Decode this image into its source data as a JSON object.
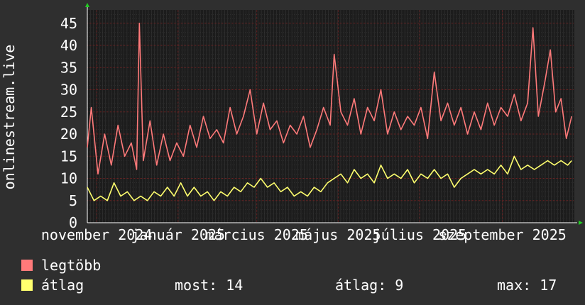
{
  "chart_data": {
    "type": "line",
    "ylabel": "onlinestream.live",
    "ylim": [
      0,
      48
    ],
    "yticks": [
      0,
      5,
      10,
      15,
      20,
      25,
      30,
      35,
      40,
      45
    ],
    "x_range": [
      "2024-10-25",
      "2025-10-25"
    ],
    "xtick_labels": [
      {
        "label": "november 2024",
        "date": "2024-11-01"
      },
      {
        "label": "január 2025",
        "date": "2025-01-01"
      },
      {
        "label": "március 2025",
        "date": "2025-03-01"
      },
      {
        "label": "május 2025",
        "date": "2025-05-01"
      },
      {
        "label": "július 2025",
        "date": "2025-07-01"
      },
      {
        "label": "szeptember 2025",
        "date": "2025-09-01"
      }
    ],
    "grid": true,
    "series": [
      {
        "name": "legtöbb",
        "color": "#ff7a7a",
        "points": [
          [
            "2024-10-25",
            17
          ],
          [
            "2024-10-28",
            26
          ],
          [
            "2024-11-02",
            11
          ],
          [
            "2024-11-07",
            20
          ],
          [
            "2024-11-12",
            13
          ],
          [
            "2024-11-17",
            22
          ],
          [
            "2024-11-22",
            15
          ],
          [
            "2024-11-27",
            18
          ],
          [
            "2024-12-01",
            12
          ],
          [
            "2024-12-03",
            45
          ],
          [
            "2024-12-06",
            14
          ],
          [
            "2024-12-11",
            23
          ],
          [
            "2024-12-16",
            13
          ],
          [
            "2024-12-21",
            20
          ],
          [
            "2024-12-26",
            14
          ],
          [
            "2024-12-31",
            18
          ],
          [
            "2025-01-05",
            15
          ],
          [
            "2025-01-10",
            22
          ],
          [
            "2025-01-15",
            17
          ],
          [
            "2025-01-20",
            24
          ],
          [
            "2025-01-25",
            19
          ],
          [
            "2025-01-30",
            21
          ],
          [
            "2025-02-04",
            18
          ],
          [
            "2025-02-09",
            26
          ],
          [
            "2025-02-14",
            20
          ],
          [
            "2025-02-19",
            24
          ],
          [
            "2025-02-24",
            30
          ],
          [
            "2025-03-01",
            20
          ],
          [
            "2025-03-06",
            27
          ],
          [
            "2025-03-11",
            21
          ],
          [
            "2025-03-16",
            23
          ],
          [
            "2025-03-21",
            18
          ],
          [
            "2025-03-26",
            22
          ],
          [
            "2025-03-31",
            20
          ],
          [
            "2025-04-05",
            24
          ],
          [
            "2025-04-10",
            17
          ],
          [
            "2025-04-15",
            21
          ],
          [
            "2025-04-20",
            26
          ],
          [
            "2025-04-25",
            22
          ],
          [
            "2025-04-28",
            38
          ],
          [
            "2025-05-03",
            25
          ],
          [
            "2025-05-08",
            22
          ],
          [
            "2025-05-13",
            28
          ],
          [
            "2025-05-18",
            20
          ],
          [
            "2025-05-23",
            26
          ],
          [
            "2025-05-28",
            23
          ],
          [
            "2025-06-02",
            30
          ],
          [
            "2025-06-07",
            20
          ],
          [
            "2025-06-12",
            25
          ],
          [
            "2025-06-17",
            21
          ],
          [
            "2025-06-22",
            24
          ],
          [
            "2025-06-27",
            22
          ],
          [
            "2025-07-02",
            26
          ],
          [
            "2025-07-07",
            19
          ],
          [
            "2025-07-12",
            34
          ],
          [
            "2025-07-17",
            23
          ],
          [
            "2025-07-22",
            27
          ],
          [
            "2025-07-27",
            22
          ],
          [
            "2025-08-01",
            26
          ],
          [
            "2025-08-06",
            20
          ],
          [
            "2025-08-11",
            25
          ],
          [
            "2025-08-16",
            21
          ],
          [
            "2025-08-21",
            27
          ],
          [
            "2025-08-26",
            22
          ],
          [
            "2025-08-31",
            26
          ],
          [
            "2025-09-05",
            24
          ],
          [
            "2025-09-10",
            29
          ],
          [
            "2025-09-15",
            23
          ],
          [
            "2025-09-20",
            27
          ],
          [
            "2025-09-24",
            44
          ],
          [
            "2025-09-28",
            24
          ],
          [
            "2025-10-03",
            32
          ],
          [
            "2025-10-07",
            39
          ],
          [
            "2025-10-11",
            25
          ],
          [
            "2025-10-15",
            28
          ],
          [
            "2025-10-19",
            19
          ],
          [
            "2025-10-23",
            24
          ]
        ]
      },
      {
        "name": "átlag",
        "color": "#ffff6e",
        "points": [
          [
            "2024-10-25",
            8
          ],
          [
            "2024-10-30",
            5
          ],
          [
            "2024-11-04",
            6
          ],
          [
            "2024-11-09",
            5
          ],
          [
            "2024-11-14",
            9
          ],
          [
            "2024-11-19",
            6
          ],
          [
            "2024-11-24",
            7
          ],
          [
            "2024-11-29",
            5
          ],
          [
            "2024-12-04",
            6
          ],
          [
            "2024-12-09",
            5
          ],
          [
            "2024-12-14",
            7
          ],
          [
            "2024-12-19",
            6
          ],
          [
            "2024-12-24",
            8
          ],
          [
            "2024-12-29",
            6
          ],
          [
            "2025-01-03",
            9
          ],
          [
            "2025-01-08",
            6
          ],
          [
            "2025-01-13",
            8
          ],
          [
            "2025-01-18",
            6
          ],
          [
            "2025-01-23",
            7
          ],
          [
            "2025-01-28",
            5
          ],
          [
            "2025-02-02",
            7
          ],
          [
            "2025-02-07",
            6
          ],
          [
            "2025-02-12",
            8
          ],
          [
            "2025-02-17",
            7
          ],
          [
            "2025-02-22",
            9
          ],
          [
            "2025-02-27",
            8
          ],
          [
            "2025-03-04",
            10
          ],
          [
            "2025-03-09",
            8
          ],
          [
            "2025-03-14",
            9
          ],
          [
            "2025-03-19",
            7
          ],
          [
            "2025-03-24",
            8
          ],
          [
            "2025-03-29",
            6
          ],
          [
            "2025-04-03",
            7
          ],
          [
            "2025-04-08",
            6
          ],
          [
            "2025-04-13",
            8
          ],
          [
            "2025-04-18",
            7
          ],
          [
            "2025-04-23",
            9
          ],
          [
            "2025-04-28",
            10
          ],
          [
            "2025-05-03",
            11
          ],
          [
            "2025-05-08",
            9
          ],
          [
            "2025-05-13",
            12
          ],
          [
            "2025-05-18",
            10
          ],
          [
            "2025-05-23",
            11
          ],
          [
            "2025-05-28",
            9
          ],
          [
            "2025-06-02",
            13
          ],
          [
            "2025-06-07",
            10
          ],
          [
            "2025-06-12",
            11
          ],
          [
            "2025-06-17",
            10
          ],
          [
            "2025-06-22",
            12
          ],
          [
            "2025-06-27",
            9
          ],
          [
            "2025-07-02",
            11
          ],
          [
            "2025-07-07",
            10
          ],
          [
            "2025-07-12",
            12
          ],
          [
            "2025-07-17",
            10
          ],
          [
            "2025-07-22",
            11
          ],
          [
            "2025-07-27",
            8
          ],
          [
            "2025-08-01",
            10
          ],
          [
            "2025-08-06",
            11
          ],
          [
            "2025-08-11",
            12
          ],
          [
            "2025-08-16",
            11
          ],
          [
            "2025-08-21",
            12
          ],
          [
            "2025-08-26",
            11
          ],
          [
            "2025-08-31",
            13
          ],
          [
            "2025-09-05",
            11
          ],
          [
            "2025-09-10",
            15
          ],
          [
            "2025-09-15",
            12
          ],
          [
            "2025-09-20",
            13
          ],
          [
            "2025-09-25",
            12
          ],
          [
            "2025-09-30",
            13
          ],
          [
            "2025-10-05",
            14
          ],
          [
            "2025-10-10",
            13
          ],
          [
            "2025-10-15",
            14
          ],
          [
            "2025-10-20",
            13
          ],
          [
            "2025-10-23",
            14
          ]
        ]
      }
    ]
  },
  "legend": {
    "max_label": "legtöbb",
    "max_color": "#ff7a7a",
    "avg_label": "átlag",
    "avg_color": "#ffff6e",
    "stat_now": "most: 14",
    "stat_avg": "átlag: 9",
    "stat_max": "max: 17"
  }
}
